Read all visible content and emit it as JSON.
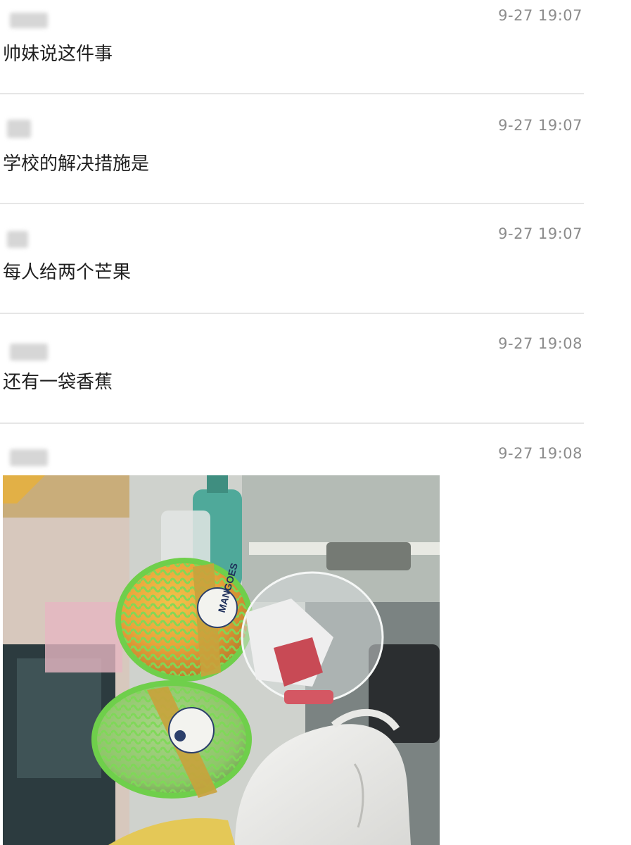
{
  "messages": [
    {
      "text": "帅妹说这件事",
      "time": "9-27 19:07"
    },
    {
      "text": "学校的解决措施是",
      "time": "9-27 19:07"
    },
    {
      "text": "每人给两个芒果",
      "time": "9-27 19:07"
    },
    {
      "text": "还有一袋香蕉",
      "time": "9-27 19:08"
    },
    {
      "text": "",
      "time": "9-27 19:08"
    }
  ],
  "photo": {
    "sticker_text": "MANGOES"
  },
  "colors": {
    "foam_net": "#7ed957",
    "mango_ripe": "#e9a23b",
    "mango_green": "#8fc56a",
    "timestamp": "#8c8c8c"
  }
}
